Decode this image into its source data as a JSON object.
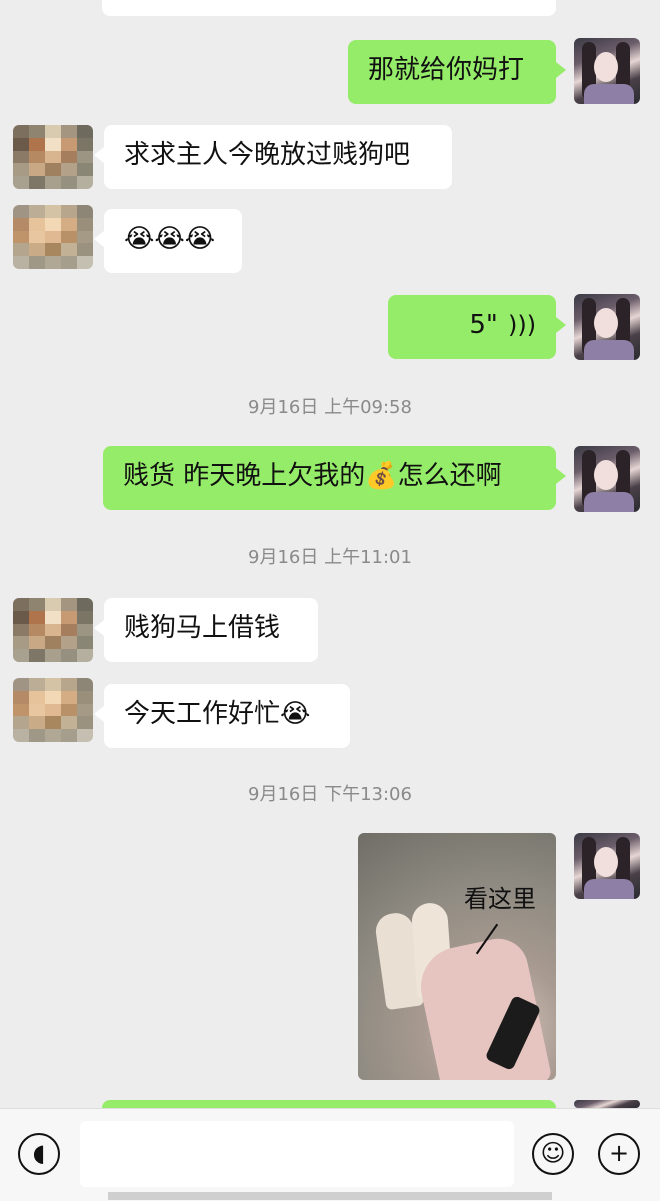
{
  "messages": [
    {
      "side": "out",
      "text": "那就给你妈打"
    },
    {
      "side": "in",
      "text": "求求主人今晚放过贱狗吧"
    },
    {
      "side": "in",
      "text": "😭😭😭"
    },
    {
      "side": "out",
      "voice_duration": "5\""
    },
    {
      "timestamp": "9月16日 上午09:58"
    },
    {
      "side": "out",
      "text": "贱货 昨天晚上欠我的💰怎么还啊"
    },
    {
      "timestamp": "9月16日 上午11:01"
    },
    {
      "side": "in",
      "text": "贱狗马上借钱"
    },
    {
      "side": "in",
      "text": "今天工作好忙😭"
    },
    {
      "timestamp": "9月16日 下午13:06"
    },
    {
      "side": "out",
      "image_caption": "看这里"
    }
  ],
  "icons": {
    "voice_toggle": "voice-icon",
    "emoji": "emoji-icon",
    "more": "plus-icon"
  },
  "colors": {
    "background": "#ededed",
    "outgoing_bubble": "#95ec69",
    "incoming_bubble": "#ffffff"
  }
}
